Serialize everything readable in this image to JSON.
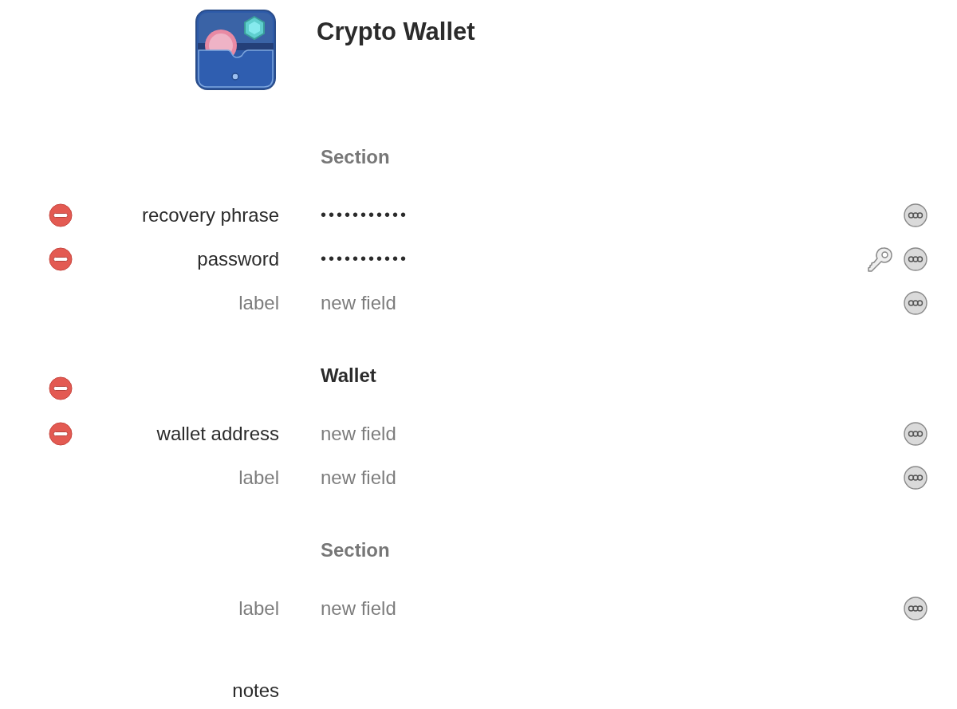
{
  "app": {
    "title": "Crypto Wallet"
  },
  "sections": [
    {
      "title": "Section",
      "title_is_placeholder": true,
      "removable": false,
      "fields": [
        {
          "label": "recovery phrase",
          "label_is_placeholder": false,
          "kind": "concealed",
          "value": "•••••••••••",
          "removable": true,
          "generator": false
        },
        {
          "label": "password",
          "label_is_placeholder": false,
          "kind": "concealed",
          "value": "•••••••••••",
          "removable": true,
          "generator": true
        },
        {
          "label": "label",
          "label_is_placeholder": true,
          "kind": "text",
          "placeholder": "new field",
          "removable": false,
          "generator": false
        }
      ]
    },
    {
      "title": "Wallet",
      "title_is_placeholder": false,
      "removable": true,
      "fields": [
        {
          "label": "wallet address",
          "label_is_placeholder": false,
          "kind": "text",
          "placeholder": "new field",
          "removable": true,
          "generator": false
        },
        {
          "label": "label",
          "label_is_placeholder": true,
          "kind": "text",
          "placeholder": "new field",
          "removable": false,
          "generator": false
        }
      ]
    },
    {
      "title": "Section",
      "title_is_placeholder": true,
      "removable": false,
      "fields": [
        {
          "label": "label",
          "label_is_placeholder": true,
          "kind": "text",
          "placeholder": "new field",
          "removable": false,
          "generator": false
        }
      ]
    }
  ],
  "notes": {
    "label": "notes"
  }
}
